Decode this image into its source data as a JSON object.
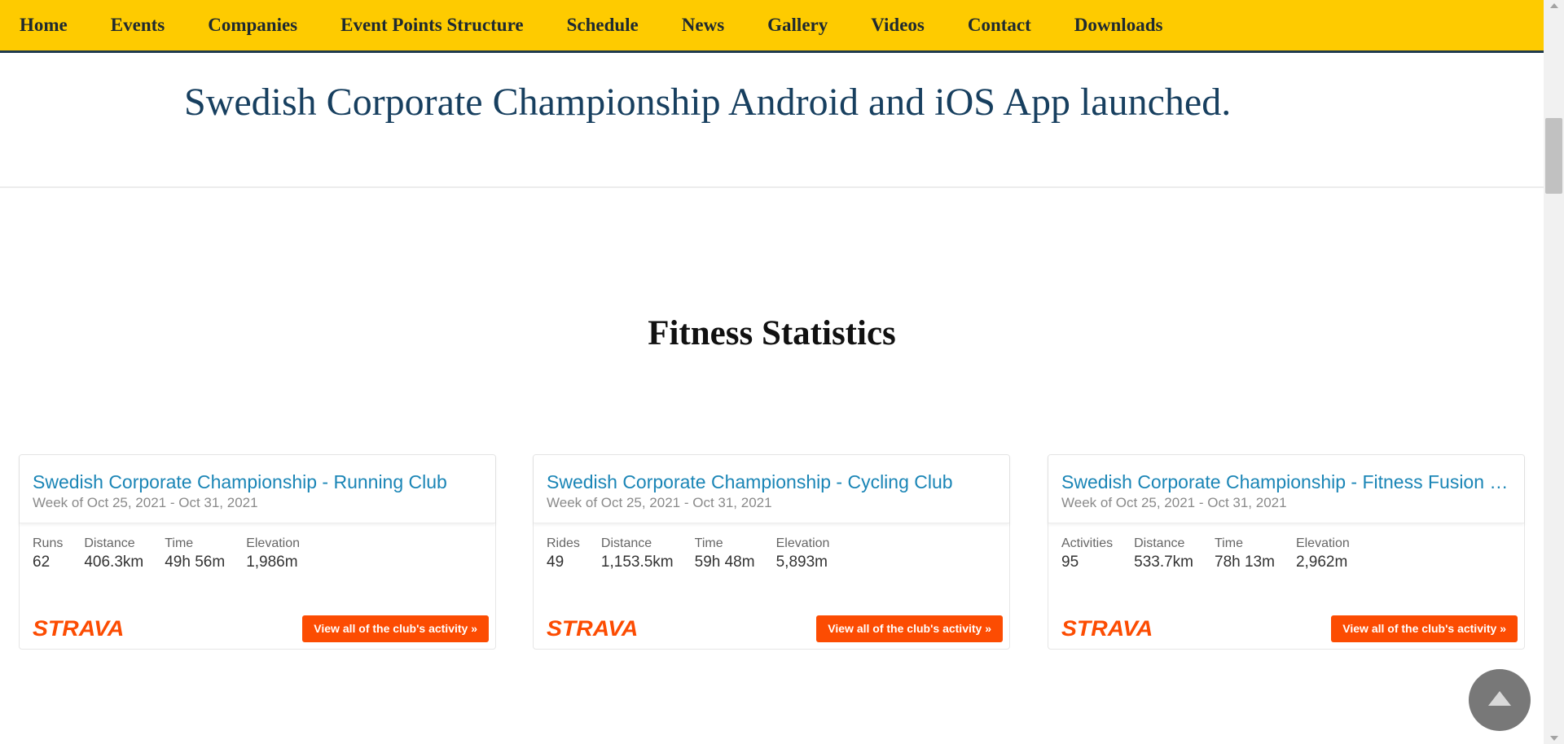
{
  "nav": {
    "items": [
      "Home",
      "Events",
      "Companies",
      "Event Points Structure",
      "Schedule",
      "News",
      "Gallery",
      "Videos",
      "Contact",
      "Downloads"
    ]
  },
  "headline": "Swedish Corporate Championship Android and iOS App launched.",
  "section_title": "Fitness Statistics",
  "cards": [
    {
      "title": "Swedish Corporate Championship - Running Club",
      "week": "Week of Oct 25, 2021 - Oct 31, 2021",
      "stats": [
        {
          "label": "Runs",
          "value": "62"
        },
        {
          "label": "Distance",
          "value": "406.3km"
        },
        {
          "label": "Time",
          "value": "49h 56m"
        },
        {
          "label": "Elevation",
          "value": "1,986m"
        }
      ],
      "logo": "STRAVA",
      "button": "View all of the club's activity »"
    },
    {
      "title": "Swedish Corporate Championship - Cycling Club",
      "week": "Week of Oct 25, 2021 - Oct 31, 2021",
      "stats": [
        {
          "label": "Rides",
          "value": "49"
        },
        {
          "label": "Distance",
          "value": "1,153.5km"
        },
        {
          "label": "Time",
          "value": "59h 48m"
        },
        {
          "label": "Elevation",
          "value": "5,893m"
        }
      ],
      "logo": "STRAVA",
      "button": "View all of the club's activity »"
    },
    {
      "title": "Swedish Corporate Championship - Fitness Fusion Club",
      "week": "Week of Oct 25, 2021 - Oct 31, 2021",
      "stats": [
        {
          "label": "Activities",
          "value": "95"
        },
        {
          "label": "Distance",
          "value": "533.7km"
        },
        {
          "label": "Time",
          "value": "78h 13m"
        },
        {
          "label": "Elevation",
          "value": "2,962m"
        }
      ],
      "logo": "STRAVA",
      "button": "View all of the club's activity »"
    }
  ],
  "colors": {
    "nav_background": "#fecb00",
    "headline": "#173f5f",
    "card_title": "#1a85b6",
    "strava_orange": "#fc4c02"
  },
  "icons": {
    "back_to_top": "triangle-up-icon"
  }
}
